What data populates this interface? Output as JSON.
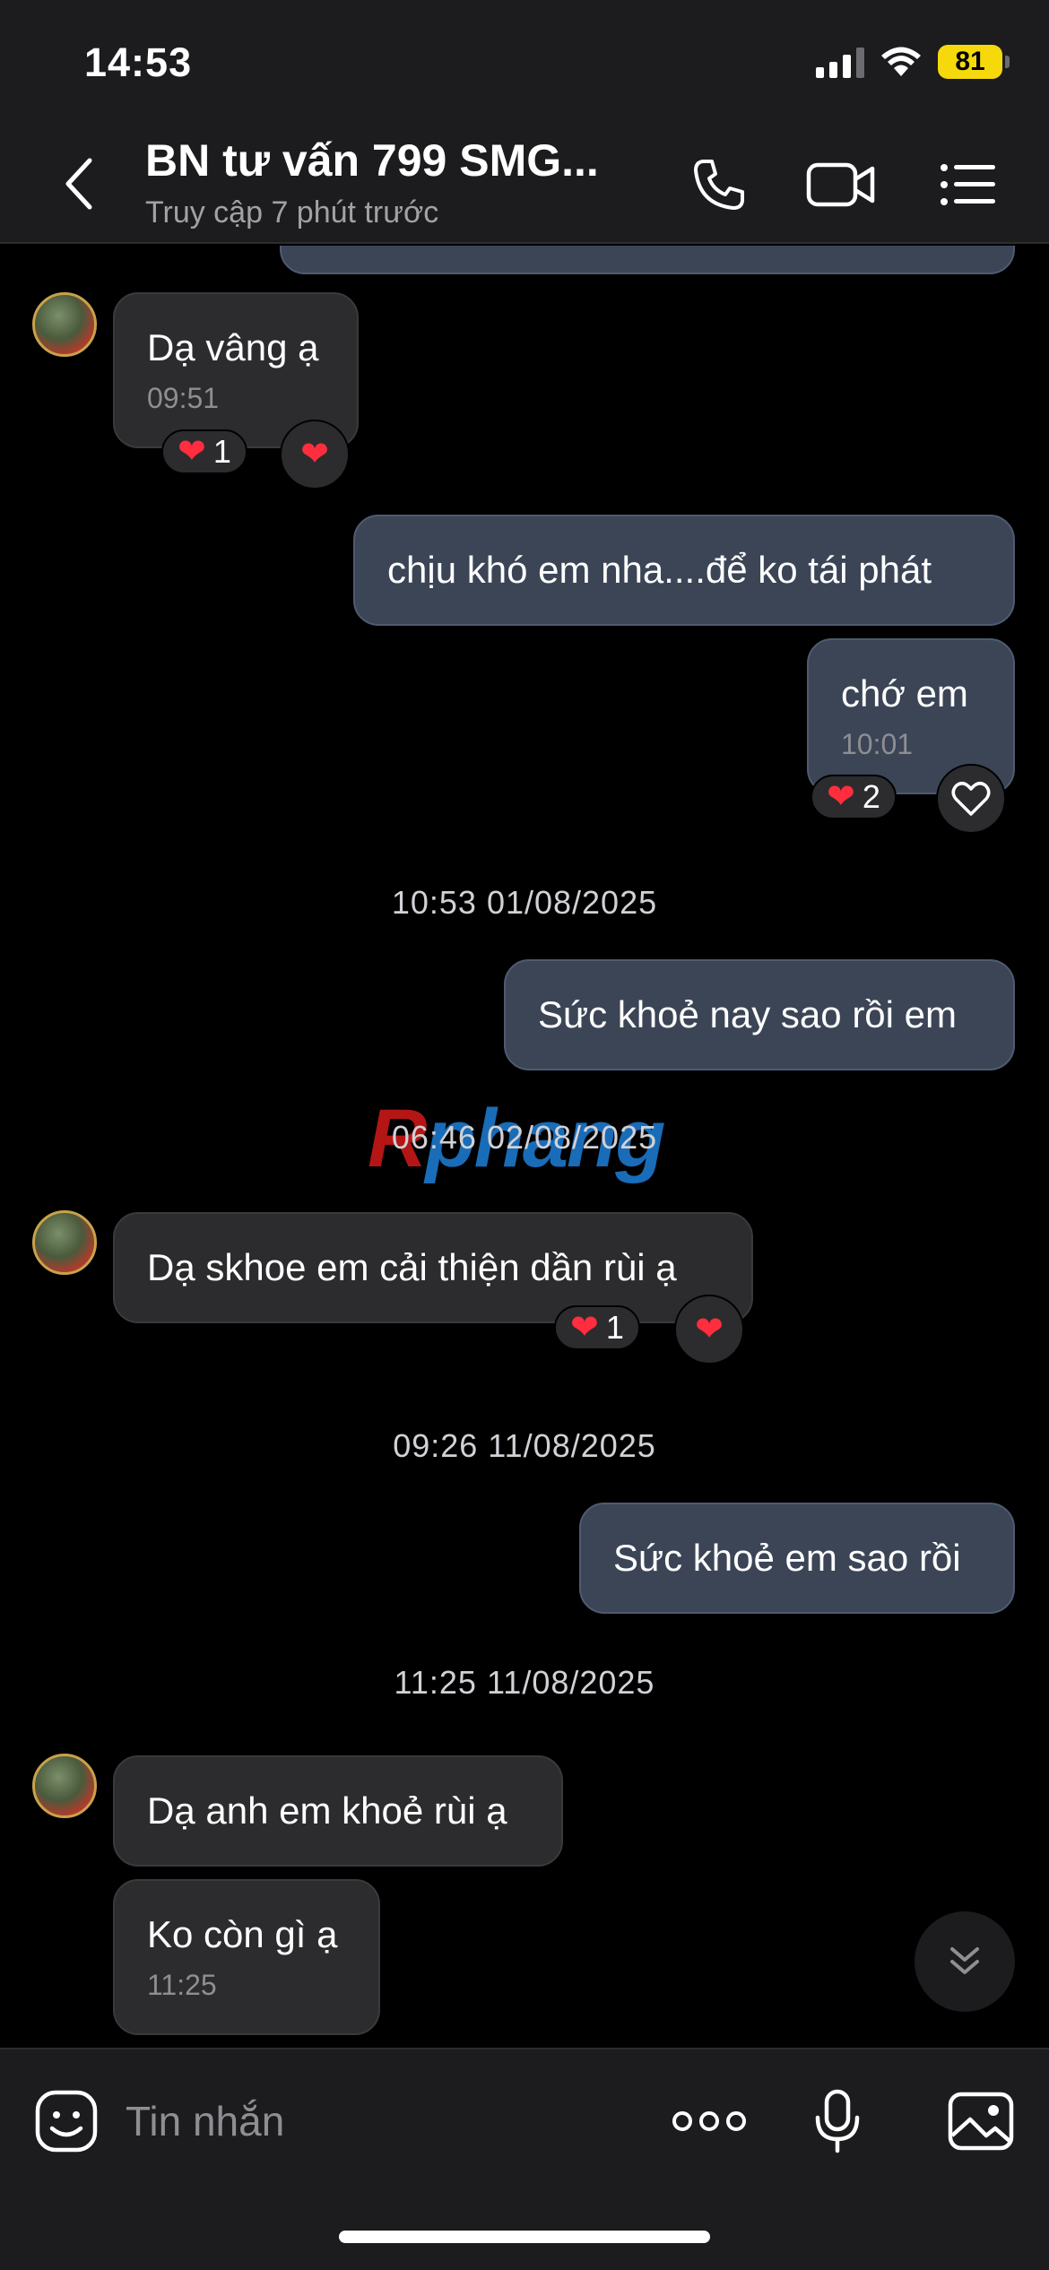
{
  "status_bar": {
    "time": "14:53",
    "battery": "81"
  },
  "header": {
    "title": "BN tư vấn 799 SMG...",
    "subtitle": "Truy cập 7 phút trước",
    "icons": [
      "chevron-left-icon",
      "phone-icon",
      "video-icon",
      "list-menu-icon"
    ]
  },
  "messages": [
    {
      "sender": "contact",
      "text": "Dạ vâng ạ",
      "time": "09:51",
      "reaction_count": "1"
    },
    {
      "sender": "me",
      "text": "chịu khó em nha....để ko tái phát"
    },
    {
      "sender": "me",
      "text": "chớ em",
      "time": "10:01",
      "reaction_count": "2"
    },
    {
      "date_separator": "10:53 01/08/2025"
    },
    {
      "sender": "me",
      "text": "Sức khoẻ nay sao rồi em"
    },
    {
      "date_separator": "06:46 02/08/2025"
    },
    {
      "sender": "contact",
      "text": "Dạ skhoe em cải thiện dần rùi ạ",
      "reaction_count": "1"
    },
    {
      "date_separator": "09:26 11/08/2025"
    },
    {
      "sender": "me",
      "text": "Sức khoẻ em sao rồi"
    },
    {
      "date_separator": "11:25 11/08/2025"
    },
    {
      "sender": "contact",
      "text": "Dạ anh em khoẻ rùi ạ"
    },
    {
      "sender": "contact",
      "text": "Ko còn gì ạ",
      "time": "11:25"
    }
  ],
  "watermark": {
    "part1": "R",
    "part2": "phang"
  },
  "input_bar": {
    "placeholder": "Tin nhắn",
    "icons": [
      "emoji-icon",
      "more-icon",
      "microphone-icon",
      "image-icon"
    ]
  },
  "colors": {
    "background": "#000000",
    "incoming_bubble": "#2c2c2e",
    "outgoing_bubble": "#3b4556",
    "heart": "#ff2d3d",
    "battery": "#f5d90a"
  }
}
